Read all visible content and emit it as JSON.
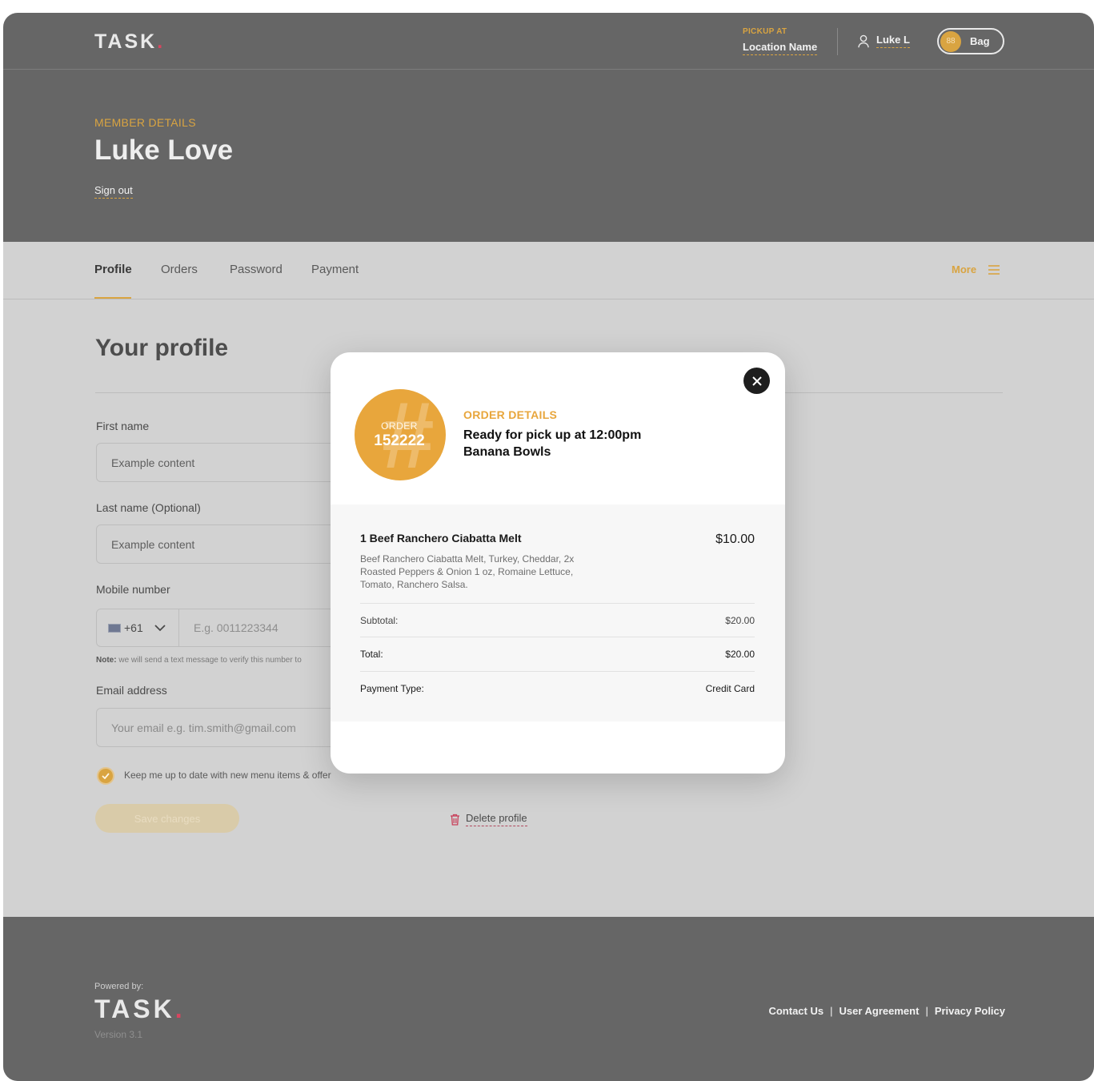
{
  "brand": {
    "name": "TASK",
    "dot": "."
  },
  "topbar": {
    "pickup_label": "PICKUP AT",
    "pickup_location": "Location Name",
    "user_name": "Luke L",
    "bag_count": "88",
    "bag_label": "Bag"
  },
  "member": {
    "label": "MEMBER DETAILS",
    "name": "Luke Love",
    "sign_out": "Sign out"
  },
  "tabs": [
    {
      "label": "Profile",
      "active": true
    },
    {
      "label": "Orders"
    },
    {
      "label": "Password"
    },
    {
      "label": "Payment"
    }
  ],
  "more_label": "More",
  "profile": {
    "title": "Your profile",
    "first_name_label": "First name",
    "first_name_value": "Example content",
    "last_name_label": "Last name (Optional)",
    "last_name_value": "Example content",
    "mobile_label": "Mobile number",
    "country_code": "+61",
    "mobile_placeholder": "E.g. 0011223344",
    "note_prefix": "Note:",
    "note_text": "we will send a text message to verify this number to",
    "email_label": "Email address",
    "email_placeholder": "Your email e.g. tim.smith@gmail.com",
    "newsletter_label": "Keep me up to date with new menu items & offer",
    "save_label": "Save changes",
    "delete_label": "Delete profile"
  },
  "footer": {
    "powered_by": "Powered by:",
    "version": "Version 3.1",
    "links": [
      "Contact Us",
      "User Agreement",
      "Privacy Policy"
    ],
    "separator": "|"
  },
  "modal": {
    "order_label": "ORDER",
    "order_number": "152222",
    "details_label": "ORDER DETAILS",
    "ready_text": "Ready for pick up at 12:00pm",
    "store_name": "Banana Bowls",
    "item_name": "1 Beef Ranchero Ciabatta Melt",
    "item_price": "$10.00",
    "item_description": "Beef Ranchero Ciabatta Melt, Turkey, Cheddar, 2x Roasted Peppers & Onion 1 oz, Romaine Lettuce, Tomato, Ranchero Salsa.",
    "subtotal_label": "Subtotal:",
    "subtotal_value": "$20.00",
    "total_label": "Total:",
    "total_value": "$20.00",
    "payment_type_label": "Payment Type:",
    "payment_type_value": "Credit Card"
  },
  "colors": {
    "accent": "#d9a441",
    "brand_dot": "#d8455f",
    "header_bg": "#666666",
    "page_bg": "#d2d2d2",
    "order_badge": "#e8a63c"
  },
  "icons": [
    "user-icon",
    "menu-icon",
    "chevron-down-icon",
    "check-icon",
    "trash-icon",
    "close-icon",
    "flag-icon"
  ]
}
